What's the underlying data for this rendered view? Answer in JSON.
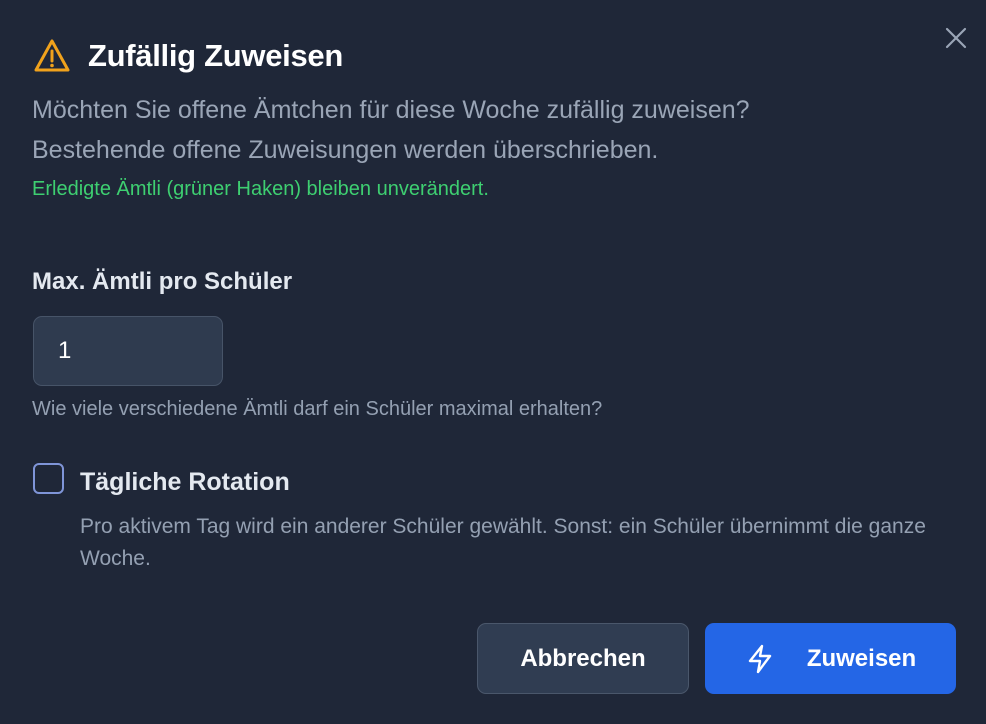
{
  "dialog": {
    "title": "Zufällig Zuweisen",
    "title_icon": "warning-triangle-icon",
    "close_icon": "close-icon",
    "description_line1": "Möchten Sie offene Ämtchen für diese Woche zufällig zuweisen?",
    "description_line2": "Bestehende offene Zuweisungen werden überschrieben.",
    "note": "Erledigte Ämtli (grüner Haken) bleiben unverändert."
  },
  "max_field": {
    "label": "Max. Ämtli pro Schüler",
    "value": "1",
    "hint": "Wie viele verschiedene Ämtli darf ein Schüler maximal erhalten?"
  },
  "rotation": {
    "label": "Tägliche Rotation",
    "checked": false,
    "description": "Pro aktivem Tag wird ein anderer Schüler gewählt. Sonst: ein Schüler übernimmt die ganze Woche."
  },
  "buttons": {
    "cancel_label": "Abbrechen",
    "submit_label": "Zuweisen",
    "submit_icon": "lightning-bolt-icon"
  },
  "colors": {
    "background": "#1f2738",
    "warning": "#f0a21c",
    "success": "#3ecf71",
    "primary": "#2466e6",
    "checkbox_border": "#7f95d8"
  }
}
